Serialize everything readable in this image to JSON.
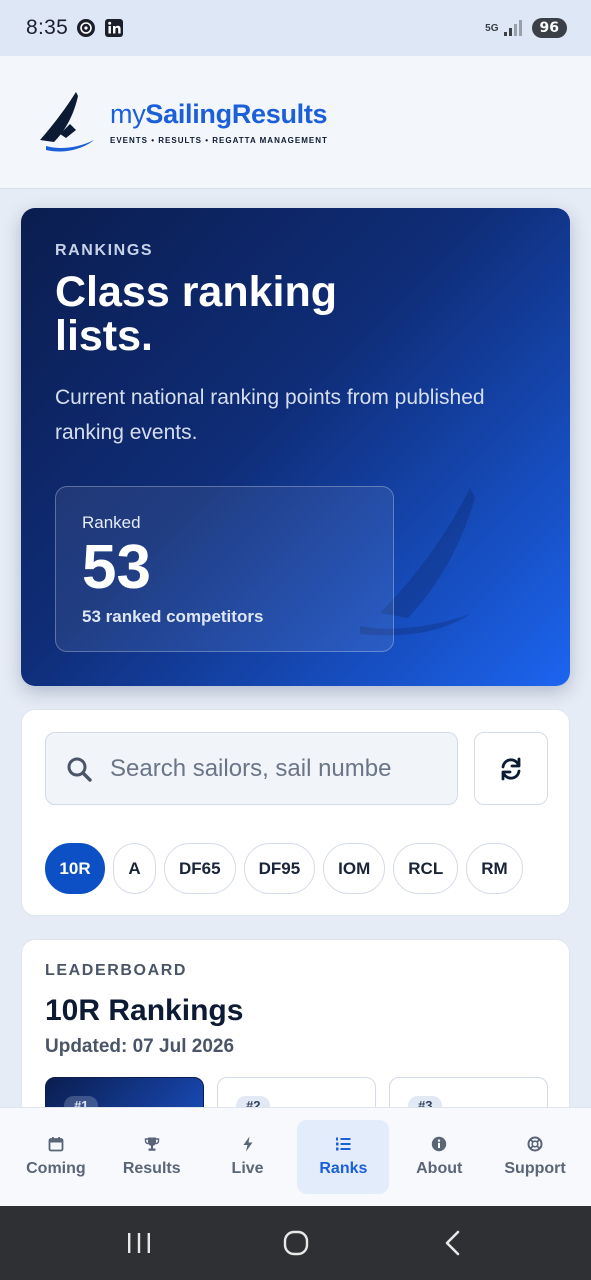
{
  "status_bar": {
    "time": "8:35",
    "network": "5G",
    "battery": "96"
  },
  "header": {
    "brand_prefix": "my",
    "brand_name": "SailingResults",
    "tagline": "EVENTS • RESULTS • REGATTA MANAGEMENT",
    "brand_color": "#1b5fd9"
  },
  "hero": {
    "eyebrow": "RANKINGS",
    "title": "Class ranking lists.",
    "subtitle": "Current national ranking points from published ranking events.",
    "stat_label": "Ranked",
    "stat_value": "53",
    "stat_caption": "53 ranked competitors"
  },
  "filters": {
    "search_placeholder": "Search sailors, sail numbe",
    "refresh_icon": "refresh-icon",
    "classes": [
      {
        "label": "10R",
        "active": true
      },
      {
        "label": "A",
        "active": false
      },
      {
        "label": "DF65",
        "active": false
      },
      {
        "label": "DF95",
        "active": false
      },
      {
        "label": "IOM",
        "active": false
      },
      {
        "label": "RCL",
        "active": false
      },
      {
        "label": "RM",
        "active": false
      }
    ]
  },
  "leaderboard": {
    "eyebrow": "LEADERBOARD",
    "title": "10R Rankings",
    "updated": "Updated: 07 Jul 2026",
    "podium": [
      {
        "rank": "#1"
      },
      {
        "rank": "#2"
      },
      {
        "rank": "#3"
      }
    ]
  },
  "nav": {
    "items": [
      {
        "label": "Coming",
        "icon": "calendar-icon",
        "active": false
      },
      {
        "label": "Results",
        "icon": "trophy-icon",
        "active": false
      },
      {
        "label": "Live",
        "icon": "bolt-icon",
        "active": false
      },
      {
        "label": "Ranks",
        "icon": "list-ol-icon",
        "active": true
      },
      {
        "label": "About",
        "icon": "info-icon",
        "active": false
      },
      {
        "label": "Support",
        "icon": "lifebuoy-icon",
        "active": false
      }
    ]
  }
}
